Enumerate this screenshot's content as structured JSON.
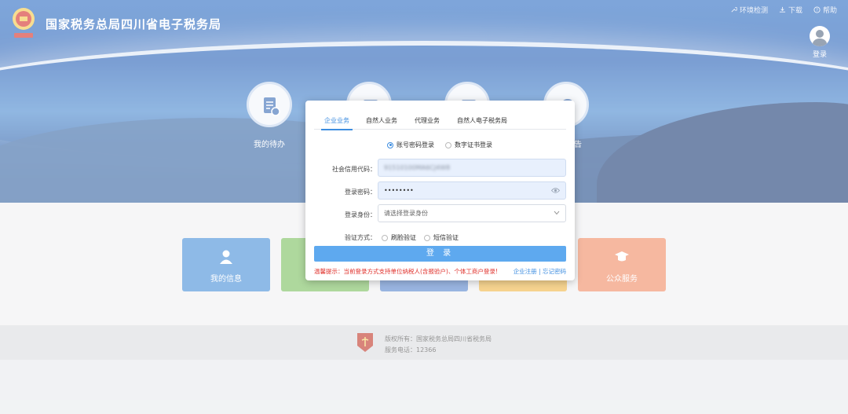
{
  "header": {
    "site_title": "国家税务总局四川省电子税务局",
    "links": [
      "环境检测",
      "下载",
      "帮助"
    ],
    "user_label": "登录"
  },
  "hero_items": [
    {
      "label": "我的待办",
      "icon": "document-icon"
    },
    {
      "label": "",
      "icon": "calendar-icon"
    },
    {
      "label": "",
      "icon": "book-icon"
    },
    {
      "label": "告",
      "icon": "bell-icon"
    }
  ],
  "tiles": [
    {
      "label": "我的信息",
      "color": "#4a90d9",
      "icon": "person-icon"
    },
    {
      "label": "",
      "color": "#7cc062",
      "icon": "tile-icon"
    },
    {
      "label": "",
      "color": "#5b88cf",
      "icon": "tile-icon"
    },
    {
      "label": "",
      "color": "#f0b94b",
      "icon": "tile-icon"
    },
    {
      "label": "公众服务",
      "color": "#f08d67",
      "icon": "graduate-icon"
    }
  ],
  "footer": {
    "copyright": "版权所有：国家税务总局四川省税务局",
    "hotline": "服务电话：12366"
  },
  "modal": {
    "tabs": [
      "企业业务",
      "自然人业务",
      "代理业务",
      "自然人电子税务局"
    ],
    "active_tab": "企业业务",
    "login_modes": [
      "账号密码登录",
      "数字证书登录"
    ],
    "selected_mode": "账号密码登录",
    "credit_code_label": "社会信用代码：",
    "credit_code_value": "91510100MA6CJ4W8",
    "password_label": "登录密码：",
    "password_value": "••••••••",
    "identity_label": "登录身份：",
    "identity_placeholder": "请选择登录身份",
    "verify_label": "验证方式：",
    "verify_options": [
      "刷脸验证",
      "短信验证"
    ],
    "login_button": "登 录",
    "notice": "温馨提示：当前登录方式支持单位纳税人(含报验户)、个体工商户登录!",
    "register_link": "企业注册",
    "separator": "|",
    "forgot_link": "忘记密码"
  },
  "colors": {
    "accent": "#3d8de0",
    "button": "#5ea9ef",
    "notice": "#e0322c"
  }
}
